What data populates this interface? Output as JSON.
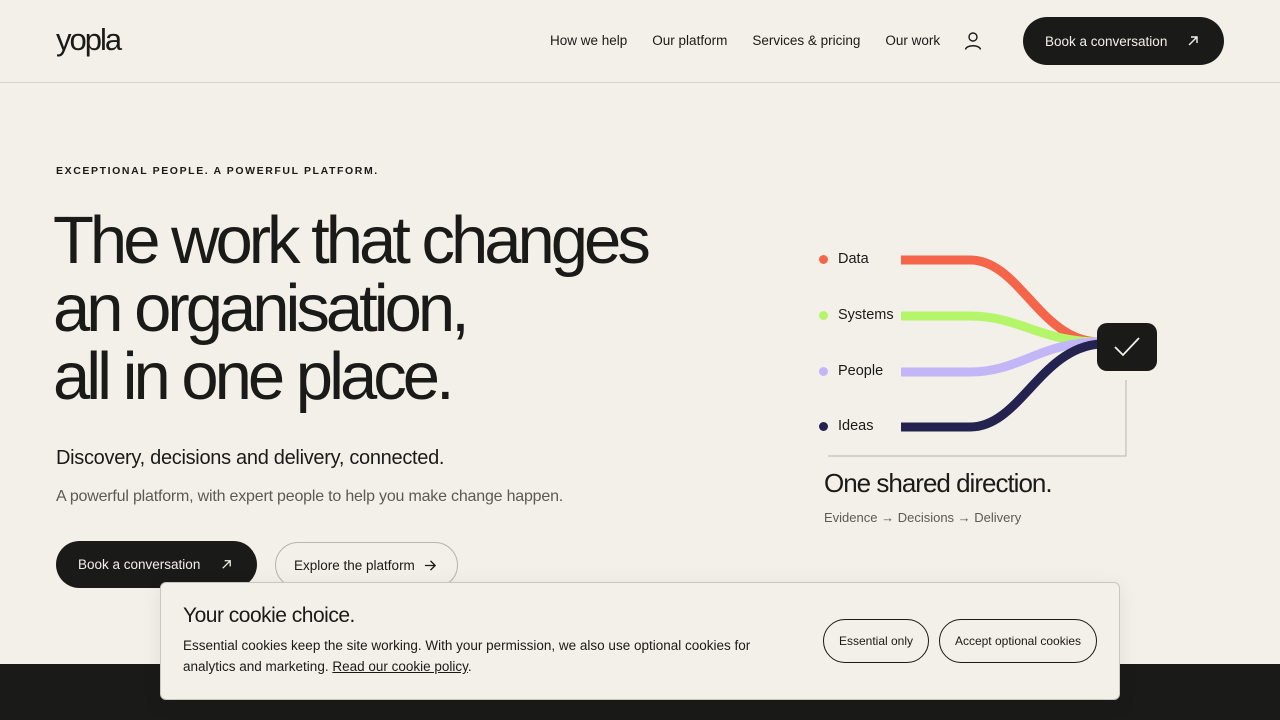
{
  "header": {
    "logo": "yopla",
    "nav": [
      "How we help",
      "Our platform",
      "Services & pricing",
      "Our work"
    ],
    "cta_label": "Book a conversation"
  },
  "hero": {
    "eyebrow": "EXCEPTIONAL PEOPLE. A POWERFUL PLATFORM.",
    "headline_lines": [
      "The work that changes",
      "an organisation,",
      "all in one place."
    ],
    "subhead": "Discovery, decisions and delivery, connected.",
    "lede": "A powerful platform, with expert people to help you make change happen.",
    "primary_cta": "Book a conversation",
    "secondary_cta": "Explore the platform"
  },
  "diagram": {
    "items": [
      {
        "label": "Data",
        "color": "#f4654a"
      },
      {
        "label": "Systems",
        "color": "#b5f56a"
      },
      {
        "label": "People",
        "color": "#c3b6f7"
      },
      {
        "label": "Ideas",
        "color": "#24224f"
      }
    ],
    "title": "One shared direction.",
    "subtitle": "Evidence → Decisions → Delivery"
  },
  "cookie": {
    "title": "Your cookie choice.",
    "text": "Essential cookies keep the site working. With your permission, we also use optional cookies for analytics and marketing. ",
    "link": "Read our cookie policy",
    "text_end": ".",
    "essential_button": "Essential only",
    "accept_button": "Accept optional cookies"
  },
  "colors": {
    "background": "#f2f0e8",
    "ink": "#1a1a18"
  }
}
